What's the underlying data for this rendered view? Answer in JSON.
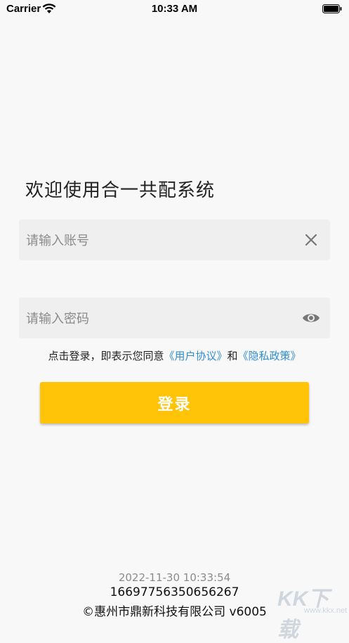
{
  "status_bar": {
    "carrier": "Carrier",
    "time": "10:33 AM"
  },
  "login": {
    "welcome": "欢迎使用合一共配系统",
    "account_placeholder": "请输入账号",
    "password_placeholder": "请输入密码",
    "agreement_prefix": "点击登录，即表示您同意",
    "user_agreement": "《用户协议》",
    "agreement_and": "和",
    "privacy_policy": "《隐私政策》",
    "login_button": "登录"
  },
  "footer": {
    "timestamp": "2022-11-30 10:33:54",
    "device_id": "16697756350656267",
    "company": "©惠州市鼎新科技有限公司 v6005"
  },
  "watermark": {
    "brand": "KK下载",
    "url": "www.kkx.net"
  },
  "colors": {
    "accent": "#ffc307",
    "link": "#2f8ed6",
    "field_bg": "#efefef",
    "page_bg": "#f8f8f8"
  }
}
